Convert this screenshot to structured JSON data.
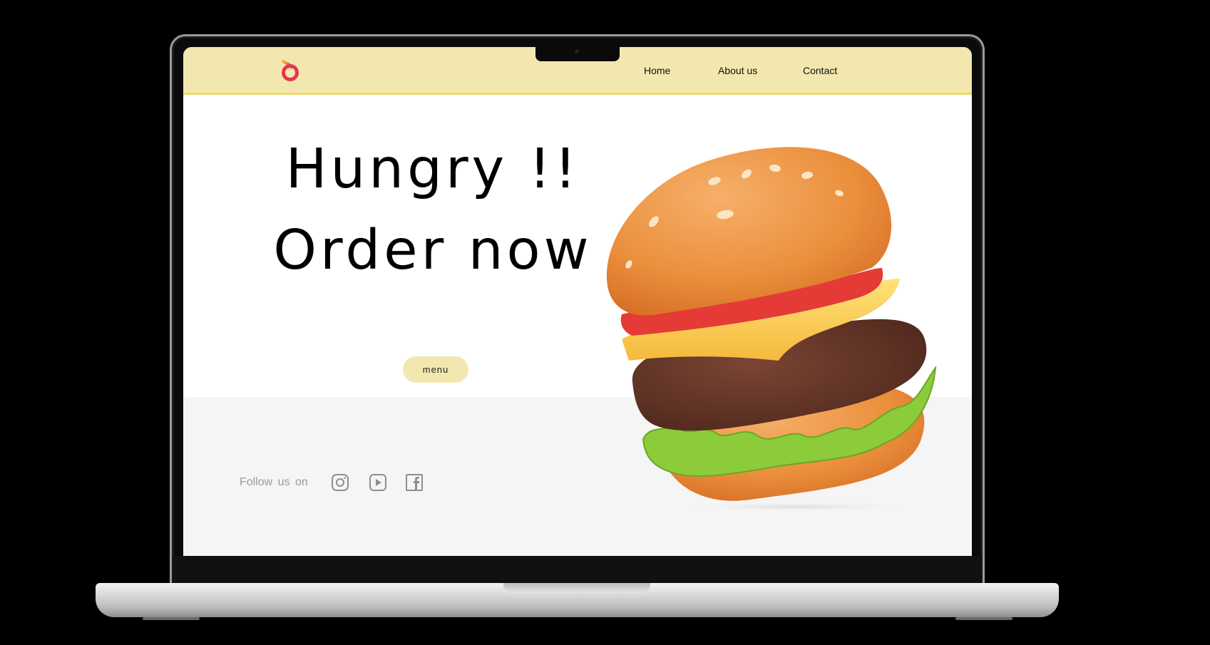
{
  "nav": {
    "logo": "flame-logo-icon",
    "links": [
      "Home",
      "About us",
      "Contact"
    ]
  },
  "hero": {
    "headline_line1": "Hungry !!",
    "headline_line2": "Order now",
    "menu_button": "menu",
    "image": "burger-illustration"
  },
  "footer": {
    "follow_label": "Follow  us on",
    "social_icons": [
      "instagram-icon",
      "youtube-icon",
      "facebook-icon"
    ]
  },
  "colors": {
    "nav_bg": "#f2e7af",
    "nav_border": "#f0da6a",
    "accent_button": "#f2e7af",
    "logo_gradient": [
      "#f7b733",
      "#e5364f"
    ],
    "footer_bg": "#f5f5f5"
  }
}
